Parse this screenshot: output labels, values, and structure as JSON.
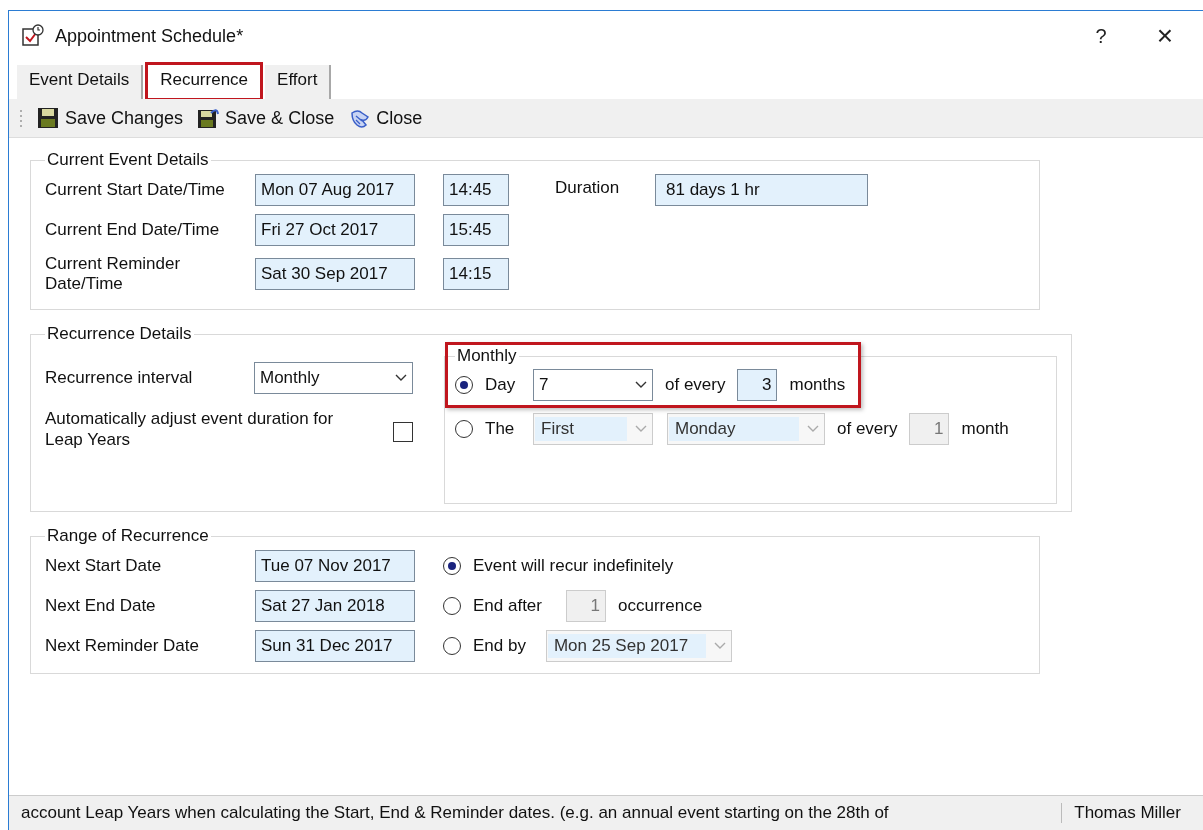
{
  "window": {
    "title": "Appointment Schedule*",
    "help": "?",
    "close": "×"
  },
  "tabs": [
    {
      "label": "Event Details",
      "selected": false,
      "highlighted": false
    },
    {
      "label": "Recurrence",
      "selected": true,
      "highlighted": true
    },
    {
      "label": "Effort",
      "selected": false,
      "highlighted": false
    }
  ],
  "toolbar": [
    {
      "kind": "save",
      "label": "Save Changes"
    },
    {
      "kind": "save_close",
      "label": "Save & Close"
    },
    {
      "kind": "close",
      "label": "Close"
    }
  ],
  "current_event": {
    "title": "Current Event Details",
    "rows": [
      {
        "label": "Current Start Date/Time",
        "date": "Mon 07 Aug 2017",
        "time": "14:45"
      },
      {
        "label": "Current End Date/Time",
        "date": "Fri 27 Oct 2017",
        "time": "15:45"
      },
      {
        "label": "Current Reminder Date/Time",
        "date": "Sat 30 Sep 2017",
        "time": "14:15"
      }
    ],
    "duration": {
      "label": "Duration",
      "value": "81 days 1 hr"
    }
  },
  "recurrence": {
    "title": "Recurrence Details",
    "interval": {
      "label": "Recurrence interval",
      "value": "Monthly"
    },
    "leap": {
      "label": "Automatically adjust event duration for Leap Years",
      "checked": false
    },
    "monthly": {
      "title": "Monthly",
      "highlighted": true,
      "options": [
        {
          "kind": "day",
          "label": "Day",
          "selected": true,
          "disabled": false,
          "day": "7",
          "of_every": "of every",
          "count": "3",
          "unit": "months"
        },
        {
          "kind": "the",
          "label": "The",
          "selected": false,
          "disabled": true,
          "ordinal": "First",
          "weekday": "Monday",
          "of_every": "of every",
          "count": "1",
          "unit": "month"
        }
      ]
    }
  },
  "range": {
    "title": "Range of Recurrence",
    "dates": [
      {
        "label": "Next Start Date",
        "value": "Tue 07 Nov 2017"
      },
      {
        "label": "Next End Date",
        "value": "Sat 27 Jan 2018"
      },
      {
        "label": "Next Reminder Date",
        "value": "Sun 31 Dec 2017"
      }
    ],
    "ends": [
      {
        "kind": "indefinite",
        "label": "Event will recur indefinitely",
        "selected": true
      },
      {
        "kind": "after",
        "label": "End after",
        "count": "1",
        "unit": "occurrence",
        "selected": false,
        "disabled": true
      },
      {
        "kind": "by",
        "label": "End by",
        "date": "Mon 25 Sep 2017",
        "selected": false,
        "disabled": true
      }
    ]
  },
  "status_bar": {
    "message": "account Leap Years when calculating the Start, End & Reminder dates. (e.g. an annual event starting on the 28th of",
    "user": "Thomas Miller"
  }
}
